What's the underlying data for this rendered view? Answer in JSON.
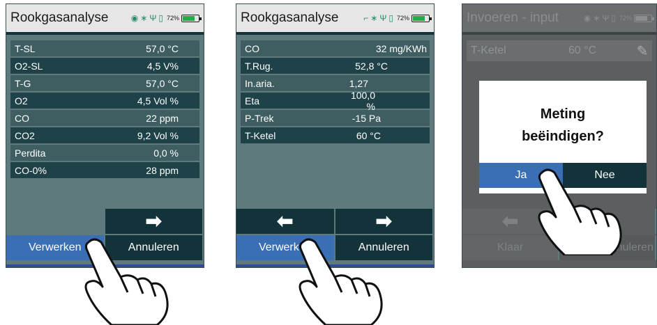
{
  "screen1": {
    "title": "Rookgasanalyse",
    "battery_pct": "72%",
    "rows": [
      {
        "label": "T-SL",
        "value": "57,0 °C"
      },
      {
        "label": "O2-SL",
        "value": "4,5 V%"
      },
      {
        "label": "T-G",
        "value": "57,0 °C"
      },
      {
        "label": "O2",
        "value": "4,5 Vol %"
      },
      {
        "label": "CO",
        "value": "22 ppm"
      },
      {
        "label": "CO2",
        "value": "9,2 Vol %"
      },
      {
        "label": "Perdita",
        "value": "0,0 %"
      },
      {
        "label": "CO-0%",
        "value": "28 ppm"
      }
    ],
    "next_arrow": "➡",
    "process_label": "Verwerken",
    "cancel_label": "Annuleren"
  },
  "screen2": {
    "title": "Rookgasanalyse",
    "battery_pct": "72%",
    "rows": [
      {
        "label": "CO",
        "value": "32 mg/KWh"
      },
      {
        "label": "T.Rug.",
        "value": "52,8 °C"
      },
      {
        "label": "In.aria.",
        "value": "1,27"
      },
      {
        "label": "Eta",
        "value": "100,0 %"
      },
      {
        "label": "P-Trek",
        "value": "-15 Pa"
      },
      {
        "label": "T-Ketel",
        "value": "60 °C"
      }
    ],
    "prev_arrow": "⬅",
    "next_arrow": "➡",
    "process_label": "Verwerken",
    "cancel_label": "Annuleren"
  },
  "screen3": {
    "title": "Invoeren - input",
    "battery_pct": "72%",
    "input": {
      "label": "T-Ketel",
      "value": "60 °C"
    },
    "dialog": {
      "line1": "Meting",
      "line2": "beëindigen?",
      "yes": "Ja",
      "no": "Nee"
    },
    "prev_arrow": "⬅",
    "done_label": "Klaar",
    "cancel_label": "Annuleren"
  },
  "colors": {
    "accent_blue": "#3a6fb5",
    "dark_teal": "#12333a",
    "panel": "#5f7a7c"
  }
}
